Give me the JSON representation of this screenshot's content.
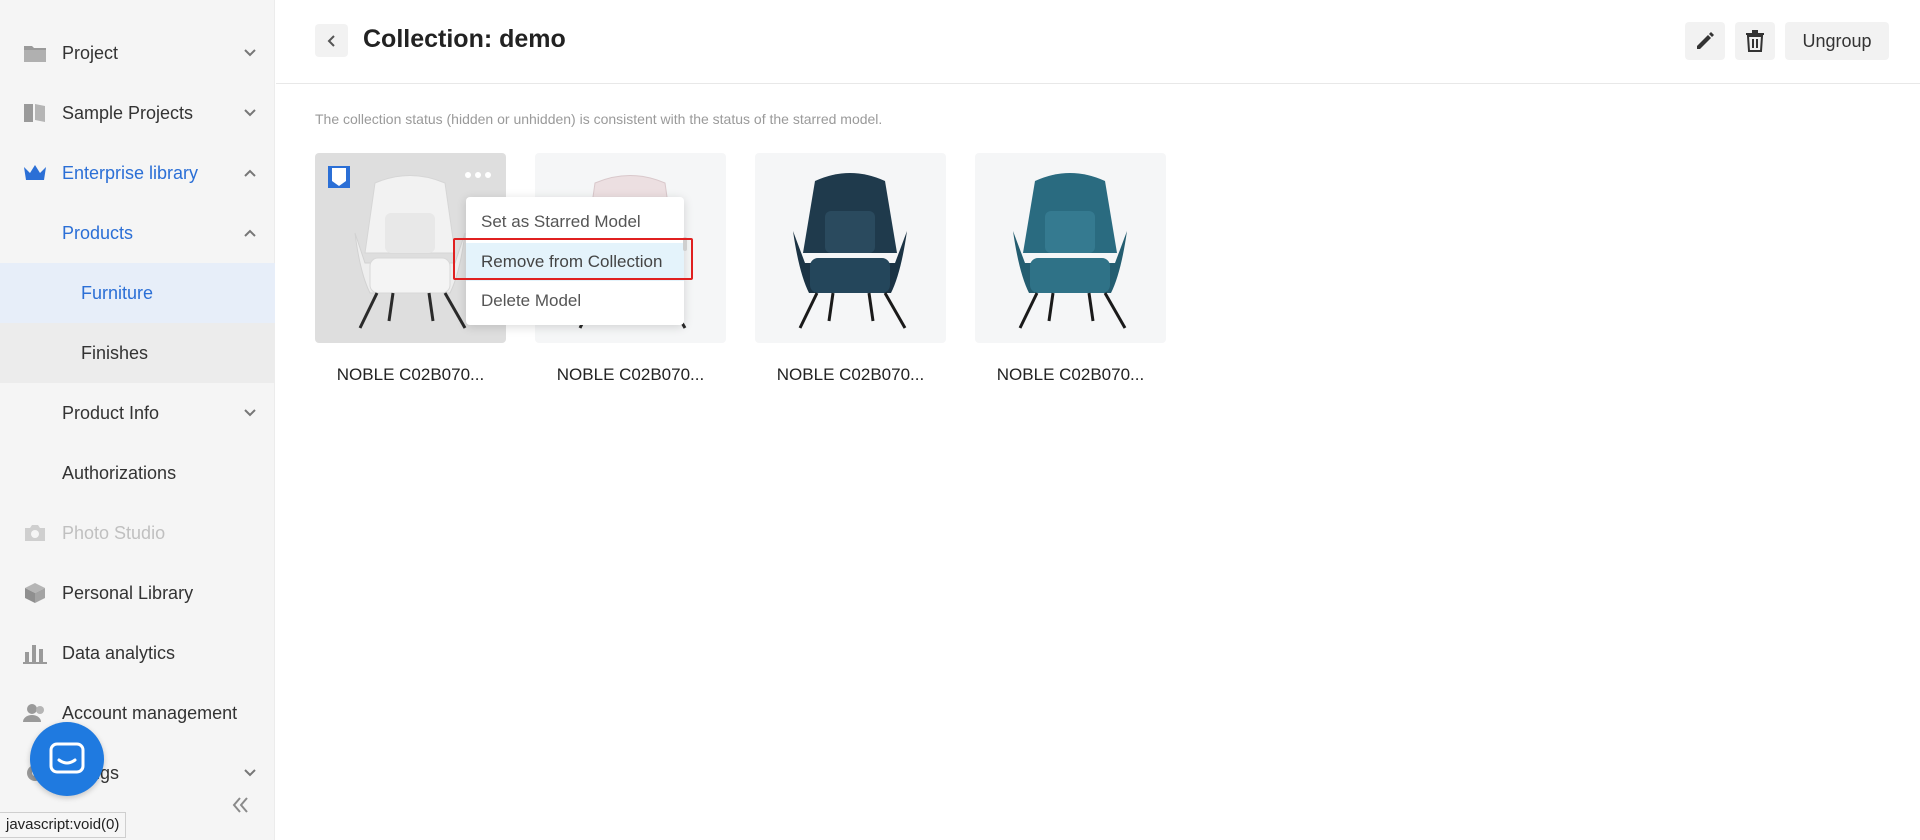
{
  "sidebar": {
    "items": [
      {
        "label": "Project",
        "icon": "folder-icon"
      },
      {
        "label": "Sample Projects",
        "icon": "book-icon"
      },
      {
        "label": "Enterprise library",
        "icon": "crown-icon"
      },
      {
        "label": "Products"
      },
      {
        "label": "Furniture"
      },
      {
        "label": "Finishes"
      },
      {
        "label": "Product Info"
      },
      {
        "label": "Authorizations"
      },
      {
        "label": "Photo Studio",
        "icon": "camera-icon"
      },
      {
        "label": "Personal Library",
        "icon": "cube-icon"
      },
      {
        "label": "Data analytics",
        "icon": "bar-chart-icon"
      },
      {
        "label": "Account management",
        "icon": "users-icon"
      },
      {
        "label": "ngs",
        "icon": "gear-icon"
      }
    ]
  },
  "status_bar": {
    "text": "javascript:void(0)"
  },
  "header": {
    "title": "Collection: demo",
    "ungroup_label": "Ungroup"
  },
  "content": {
    "note": "The collection status (hidden or unhidden) is consistent with the status of the starred model.",
    "cards": [
      {
        "label": "NOBLE C02B070...",
        "color": "#e6e6e6"
      },
      {
        "label": "NOBLE C02B070...",
        "color": "#e8d9dc"
      },
      {
        "label": "NOBLE C02B070...",
        "color": "#1f3a4c"
      },
      {
        "label": "NOBLE C02B070...",
        "color": "#2a6b80"
      }
    ]
  },
  "menu": {
    "items": [
      {
        "label": "Set as Starred Model"
      },
      {
        "label": "Remove from Collection"
      },
      {
        "label": "Delete Model"
      }
    ]
  },
  "colors": {
    "accent": "#2b6fd6",
    "highlight_box": "#e02020",
    "chat": "#1f7ae0"
  }
}
